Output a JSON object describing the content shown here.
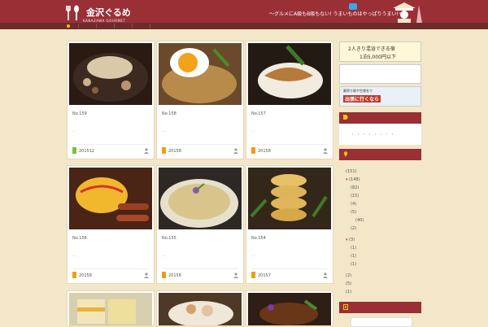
{
  "header": {
    "logo_title": "金沢ぐるめ",
    "logo_sub": "KANAZAWA GOURMET",
    "tagline": "〜グルメにA級もB級もない! うまいものはやっぱりうまい!〜"
  },
  "posts": [
    {
      "number": "No.159",
      "excerpt": "...",
      "date": "201512",
      "cat_color": "#7cbf3a"
    },
    {
      "number": "No.158",
      "excerpt": "...",
      "date": "20158",
      "cat_color": "#f39c12"
    },
    {
      "number": "No.157",
      "excerpt": "...",
      "date": "20158",
      "cat_color": "#f39c12"
    },
    {
      "number": "No.156",
      "excerpt": "...",
      "date": "20158",
      "cat_color": "#f39c12"
    },
    {
      "number": "No.155",
      "excerpt": "...",
      "date": "20158",
      "cat_color": "#f39c12"
    },
    {
      "number": "No.154",
      "excerpt": "...",
      "date": "20157",
      "cat_color": "#f39c12"
    }
  ],
  "ad1": {
    "line1": "2人きり混浴できる宿",
    "line2": "1泊5,000円以下"
  },
  "ad2": {
    "line1": "最寄り駅や空港名で",
    "line2": "出張に行くなら"
  },
  "sidebar": {
    "tags_dots": "・・・・・・・・",
    "counts": [
      "(151)",
      "(148)",
      "(82)",
      "(15)",
      "(4)",
      "(5)",
      "(40)",
      "(2)",
      "(3)",
      "(1)",
      "(1)",
      "(2)",
      "(5)",
      "(1)"
    ]
  }
}
